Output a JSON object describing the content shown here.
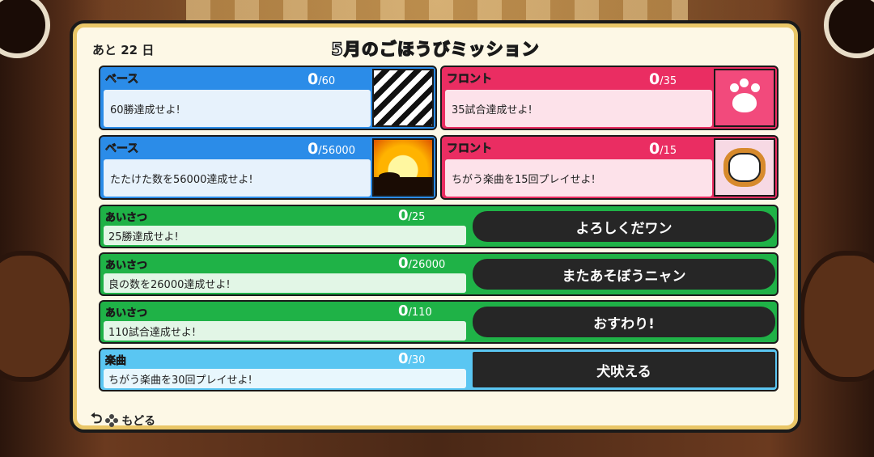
{
  "header": {
    "days_left": "あと 22 日",
    "title": "5月のごほうびミッション"
  },
  "cards": [
    {
      "category": "ベース",
      "current": "0",
      "target": "/60",
      "description": "60勝達成せよ!",
      "image": "zebra-pattern"
    },
    {
      "category": "フロント",
      "current": "0",
      "target": "/35",
      "description": "35試合達成せよ!",
      "image": "paw-icon"
    },
    {
      "category": "ベース",
      "current": "0",
      "target": "/56000",
      "description": "たたけた数を56000達成せよ!",
      "image": "savanna-sunset"
    },
    {
      "category": "フロント",
      "current": "0",
      "target": "/15",
      "description": "ちがう楽曲を15回プレイせよ!",
      "image": "cat-character"
    }
  ],
  "rows": [
    {
      "category": "あいさつ",
      "current": "0",
      "target": "/25",
      "description": "25勝達成せよ!",
      "reward": "よろしくだワン"
    },
    {
      "category": "あいさつ",
      "current": "0",
      "target": "/26000",
      "description": "良の数を26000達成せよ!",
      "reward": "またあそぼうニャン"
    },
    {
      "category": "あいさつ",
      "current": "0",
      "target": "/110",
      "description": "110試合達成せよ!",
      "reward": "おすわり!"
    },
    {
      "category": "楽曲",
      "current": "0",
      "target": "/30",
      "description": "ちがう楽曲を30回プレイせよ!",
      "reward": "犬吠える"
    }
  ],
  "footer": {
    "back_label": "もどる"
  },
  "colors": {
    "base": "#2b8ce8",
    "front": "#ea2d62",
    "greeting": "#1fb247",
    "song": "#5ac6f2",
    "panel_border": "#e9c667"
  }
}
